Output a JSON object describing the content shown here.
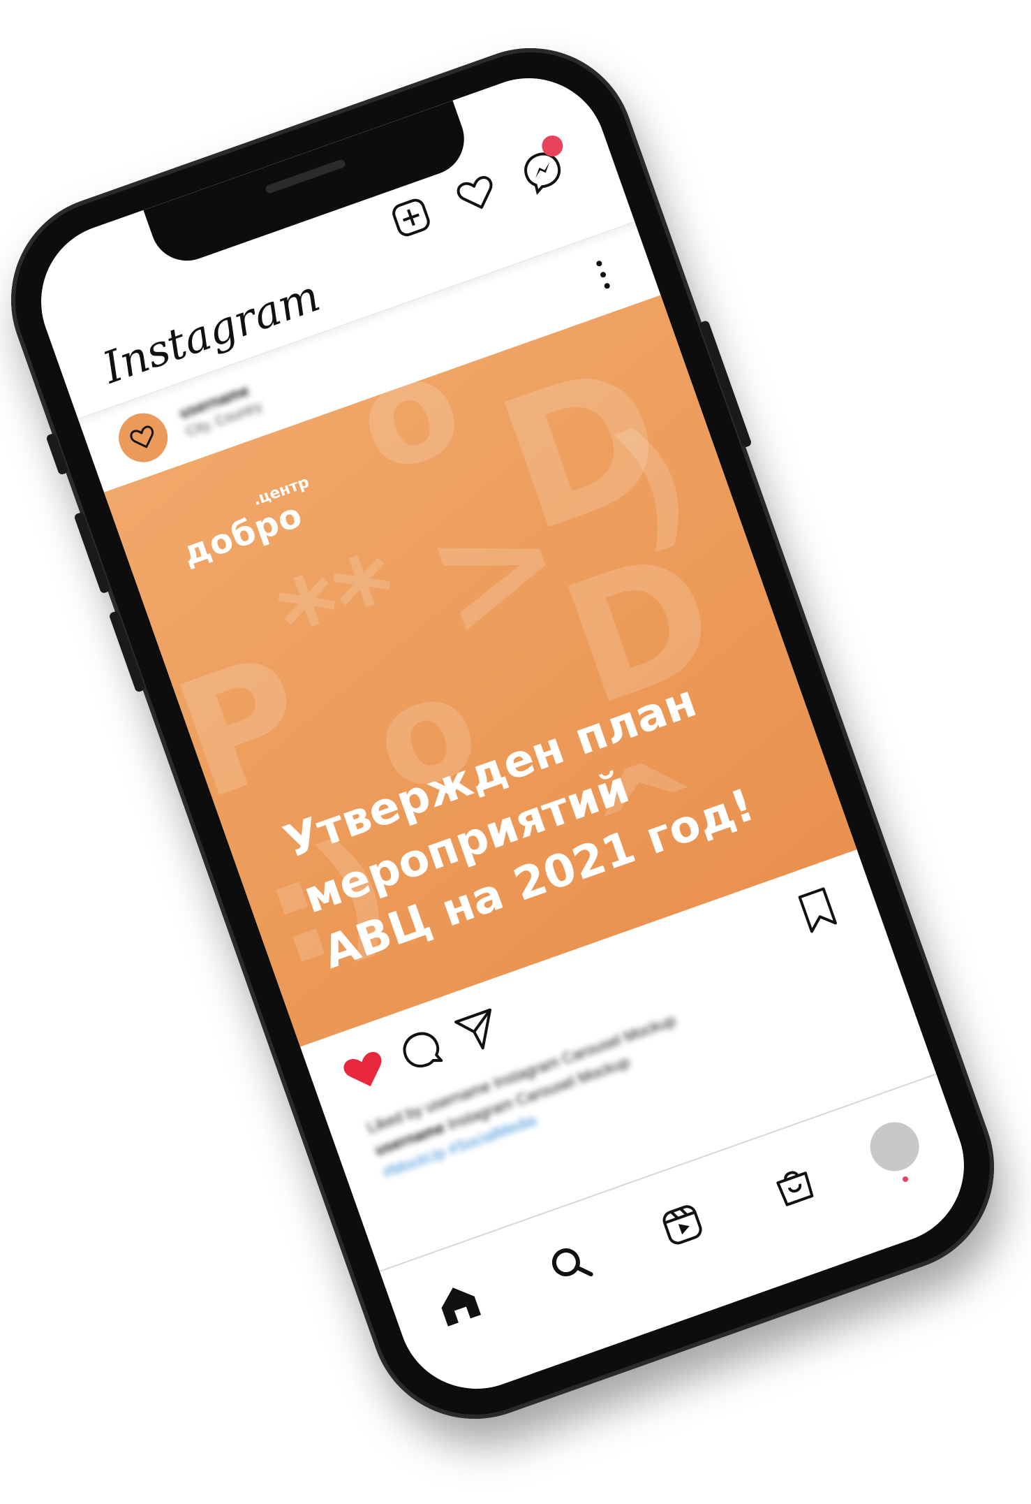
{
  "app": {
    "name": "Instagram"
  },
  "header": {
    "logo_text": "Instagram",
    "icons": [
      "new-post-icon",
      "heart-icon",
      "messenger-icon"
    ]
  },
  "post": {
    "user": {
      "name": "username",
      "location": "City, Country"
    },
    "image": {
      "brand_main": "добро",
      "brand_sub": ".центр",
      "headline_lines": [
        "Утвержден план",
        "мероприятий",
        "АВЦ на 2021 год!"
      ],
      "background_color": "#EC9A58"
    },
    "caption": {
      "likes": "Liked by username Instagram Carousel Mockup",
      "user": "username",
      "text": "Instagram Carousel Mockup",
      "tags": "#MockUp #SocialMedia"
    },
    "liked": true
  },
  "colors": {
    "like_red": "#E8293D",
    "badge_red": "#E8435A",
    "hashtag_blue": "#3B8FD8",
    "avatar_orange": "#EC9A5A"
  },
  "bottom_nav": {
    "items": [
      "home-icon",
      "search-icon",
      "reels-icon",
      "shop-icon",
      "profile-avatar"
    ]
  }
}
